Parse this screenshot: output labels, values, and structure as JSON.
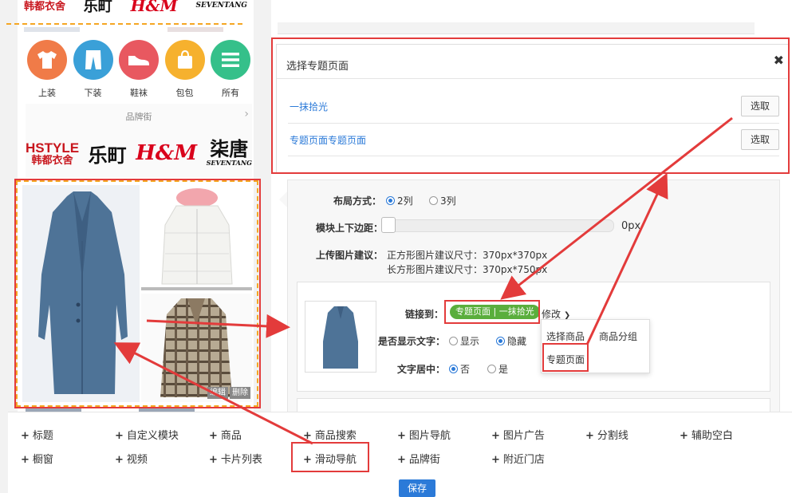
{
  "preview": {
    "top_brand_logos": [
      {
        "name": "hstyle",
        "text": "韩都衣舍"
      },
      {
        "name": "lekke",
        "text": "乐町"
      },
      {
        "name": "hm",
        "text": "H&M"
      },
      {
        "name": "seventang",
        "text": "SEVENTANG"
      }
    ],
    "categories": [
      {
        "label": "上装",
        "icon": "shirt-icon",
        "color": "#f07b48"
      },
      {
        "label": "下装",
        "icon": "pants-icon",
        "color": "#3aa0d8"
      },
      {
        "label": "鞋袜",
        "icon": "shoe-icon",
        "color": "#e85860"
      },
      {
        "label": "包包",
        "icon": "bag-icon",
        "color": "#f6b12e"
      },
      {
        "label": "所有",
        "icon": "menu-icon",
        "color": "#35c08a"
      }
    ],
    "brand_street": {
      "title": "品牌街",
      "logos": [
        {
          "name": "hstyle",
          "line1": "HSTYLE",
          "line2": "韩都衣舍"
        },
        {
          "name": "lekke",
          "line1": "乐町"
        },
        {
          "name": "hm",
          "line1": "H&M"
        },
        {
          "name": "seventang",
          "line1": "柒唐",
          "line2": "SEVENTANG"
        }
      ]
    },
    "image_actions": {
      "edit": "编辑",
      "delete": "删除"
    }
  },
  "modal": {
    "title": "选择专题页面",
    "items": [
      {
        "name": "一抹拾光",
        "button": "选取"
      },
      {
        "name": "专题页面专题页面",
        "button": "选取"
      }
    ]
  },
  "editor": {
    "layout": {
      "label": "布局方式：",
      "options": [
        "2列",
        "3列"
      ],
      "selected": "2列"
    },
    "margin": {
      "label": "模块上下边距：",
      "value": "0px"
    },
    "upload": {
      "label": "上传图片建议：",
      "lines": [
        "正方形图片建议尺寸：370px*370px",
        "长方形图片建议尺寸：370px*750px"
      ]
    },
    "link": {
      "label": "链接到：",
      "tag_type": "专题页面",
      "tag_value": "一抹拾光",
      "modify": "修改"
    },
    "show_text": {
      "label": "是否显示文字：",
      "options": [
        "显示",
        "隐藏"
      ],
      "selected": "隐藏"
    },
    "center_text": {
      "label": "文字居中：",
      "options": [
        "否",
        "是"
      ],
      "selected": "否"
    },
    "dropdown": {
      "items": [
        "选择商品",
        "商品分组",
        "专题页面"
      ]
    }
  },
  "toolbar": {
    "row1": [
      "标题",
      "自定义模块",
      "商品",
      "商品搜索",
      "图片导航",
      "图片广告",
      "分割线",
      "辅助空白"
    ],
    "row2": [
      "橱窗",
      "视频",
      "卡片列表",
      "滑动导航",
      "品牌街",
      "附近门店"
    ],
    "save": "保存"
  },
  "colors": {
    "accent_blue": "#2b7ad8",
    "tag_green": "#5aae3c",
    "highlight_red": "#e33b3b"
  }
}
